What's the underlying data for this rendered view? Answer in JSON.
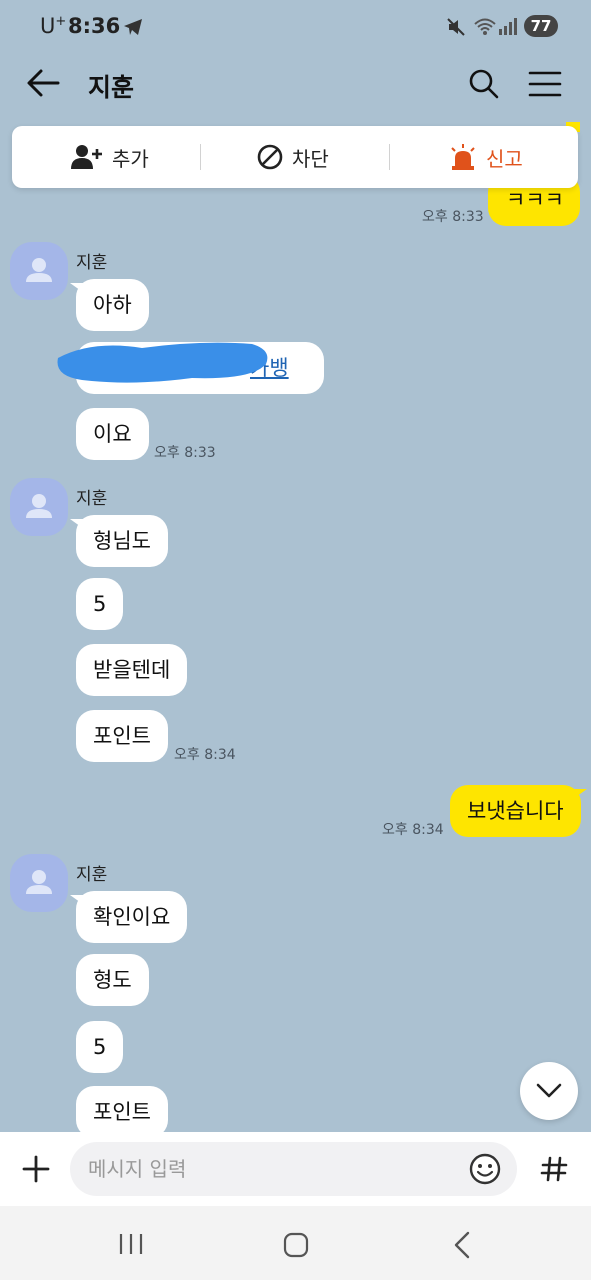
{
  "status_bar": {
    "carrier": "U",
    "carrier_sup": "+",
    "time": "8:36",
    "battery": "77"
  },
  "header": {
    "title": "지훈"
  },
  "actions": {
    "add": "추가",
    "block": "차단",
    "report": "신고"
  },
  "colors": {
    "background": "#abc1d1",
    "my_bubble": "#fee500",
    "report_accent": "#e0521b",
    "link": "#1f64b3"
  },
  "messages": {
    "partial_top_text": "ㅋㅋㅋ",
    "partial_top_time": "오후 8:33",
    "group1": {
      "sender": "지훈",
      "m1": "아하",
      "m2_link": "카뱅",
      "m3": "이요",
      "time": "오후 8:33"
    },
    "group2": {
      "sender": "지훈",
      "m1": "형님도",
      "m2": "5",
      "m3": "받을텐데",
      "m4": "포인트",
      "time": "오후 8:34"
    },
    "mine1": {
      "text": "보냇습니다",
      "time": "오후 8:34"
    },
    "group3": {
      "sender": "지훈",
      "m1": "확인이요",
      "m2": "형도",
      "m3": "5",
      "m4": "포인트"
    }
  },
  "input": {
    "placeholder": "메시지 입력"
  }
}
